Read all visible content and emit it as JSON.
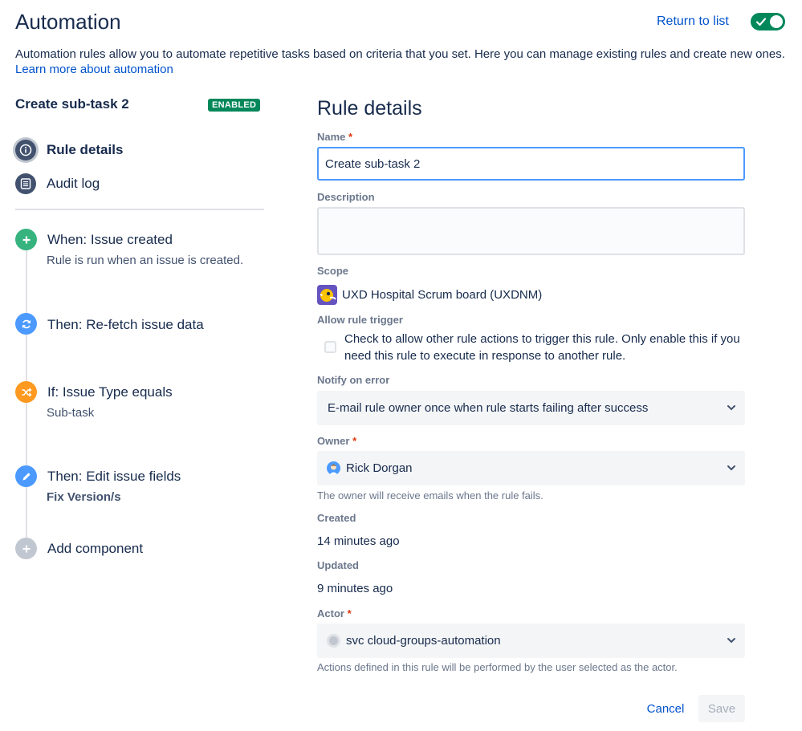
{
  "header": {
    "title": "Automation",
    "return_link": "Return to list",
    "toggle_on": true
  },
  "intro": {
    "text": "Automation rules allow you to automate repetitive tasks based on criteria that you set. Here you can manage existing rules and create new ones.",
    "learn_more": "Learn more about automation"
  },
  "sidebar": {
    "rule_name": "Create sub-task 2",
    "status_badge": "ENABLED",
    "nav": [
      {
        "label": "Rule details",
        "icon": "info-icon",
        "active": true
      },
      {
        "label": "Audit log",
        "icon": "list-icon",
        "active": false
      }
    ],
    "steps": [
      {
        "title": "When: Issue created",
        "subtitle": "Rule is run when an issue is created.",
        "icon": "plus-icon",
        "color": "#36B37E"
      },
      {
        "title": "Then: Re-fetch issue data",
        "subtitle": "",
        "icon": "refresh-icon",
        "color": "#4C9AFF"
      },
      {
        "title": "If: Issue Type equals",
        "subtitle": "Sub-task",
        "icon": "shuffle-icon",
        "color": "#FF991F"
      },
      {
        "title": "Then: Edit issue fields",
        "subtitle": "Fix Version/s",
        "icon": "pencil-icon",
        "color": "#4C9AFF"
      },
      {
        "title": "Add component",
        "subtitle": "",
        "icon": "add-icon",
        "color": "#C1C7D0"
      }
    ]
  },
  "form": {
    "title": "Rule details",
    "name_label": "Name",
    "name_value": "Create sub-task 2",
    "description_label": "Description",
    "description_value": "",
    "scope_label": "Scope",
    "scope_value": "UXD Hospital Scrum board (UXDNM)",
    "allow_trigger_label": "Allow rule trigger",
    "allow_trigger_text": "Check to allow other rule actions to trigger this rule. Only enable this if you need this rule to execute in response to another rule.",
    "allow_trigger_checked": false,
    "notify_label": "Notify on error",
    "notify_value": "E-mail rule owner once when rule starts failing after success",
    "owner_label": "Owner",
    "owner_value": "Rick Dorgan",
    "owner_help": "The owner will receive emails when the rule fails.",
    "created_label": "Created",
    "created_value": "14 minutes ago",
    "updated_label": "Updated",
    "updated_value": "9 minutes ago",
    "actor_label": "Actor",
    "actor_value": "svc cloud-groups-automation",
    "actor_help": "Actions defined in this rule will be performed by the user selected as the actor.",
    "required_mark": "*",
    "cancel_label": "Cancel",
    "save_label": "Save"
  },
  "colors": {
    "accent": "#0052CC",
    "enabled": "#00875A",
    "focus_border": "#4C9AFF",
    "required": "#DE350B"
  }
}
